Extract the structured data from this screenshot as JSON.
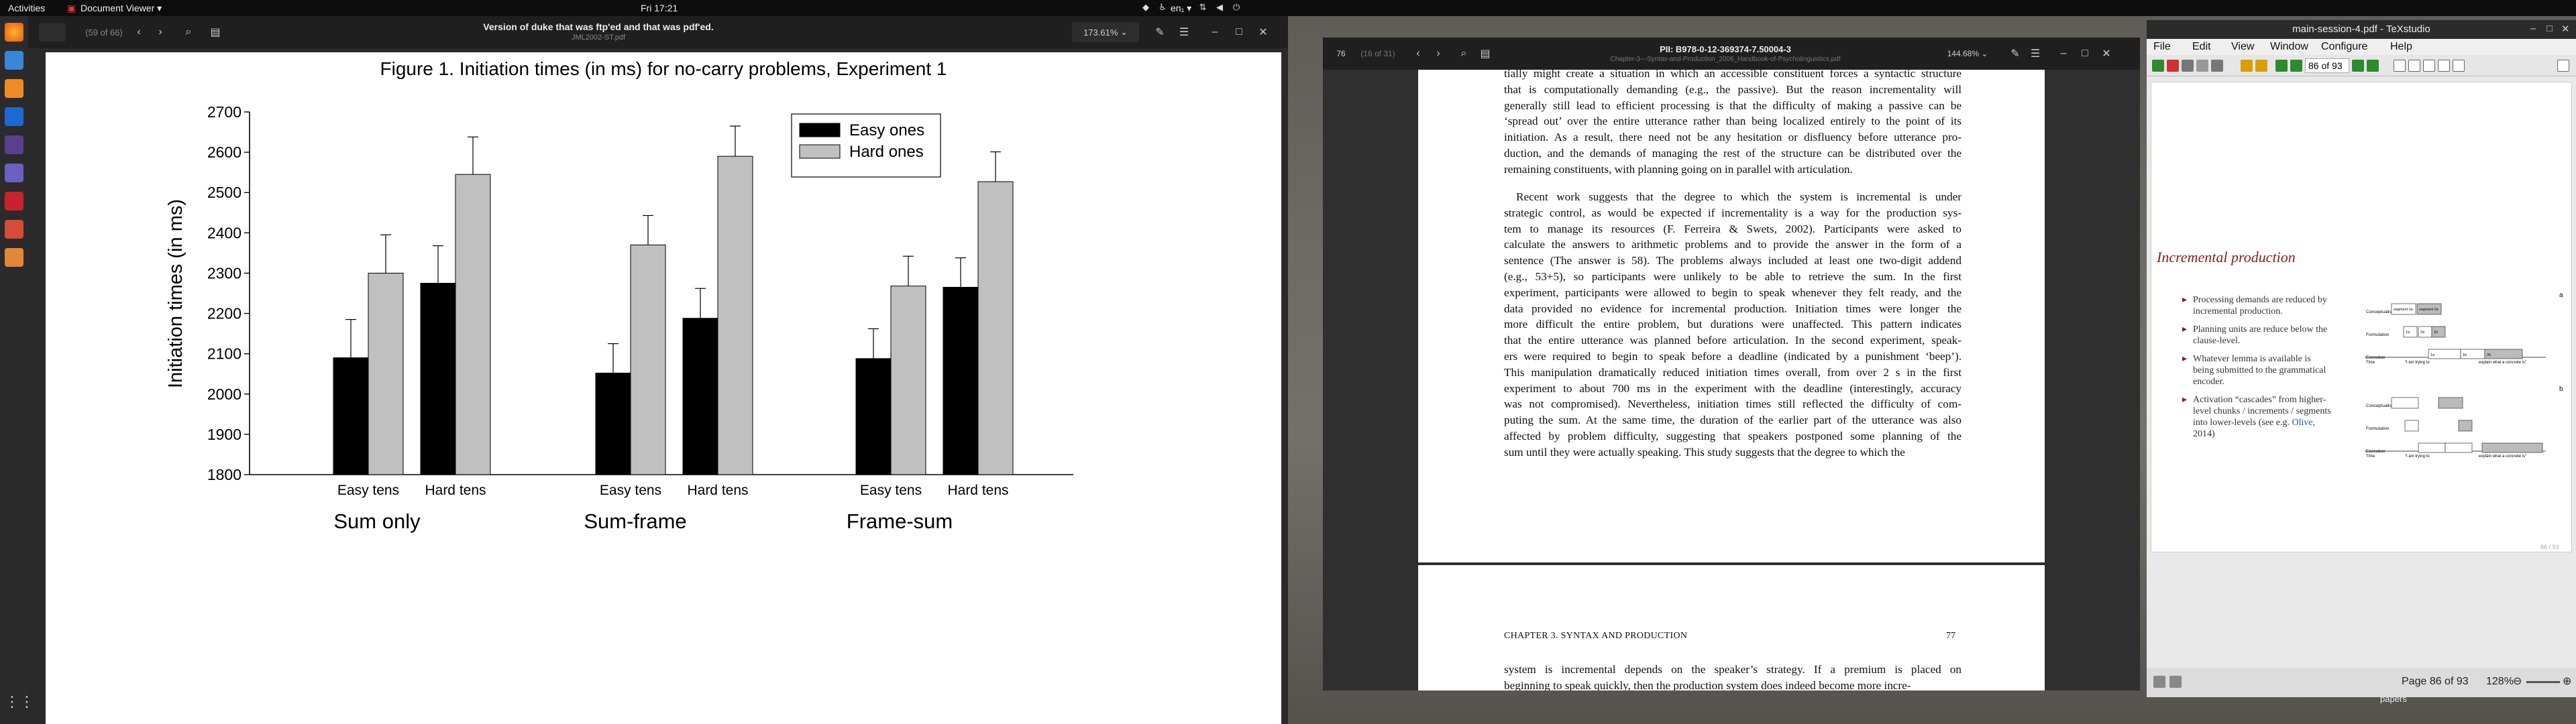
{
  "topbar": {
    "activities": "Activities",
    "app_menu": "Document Viewer ▾",
    "clock": "Fri 17:21",
    "lang": "en₁ ▾"
  },
  "viewer1": {
    "page_count": "(59 of 66)",
    "title": "Version of duke that was ftp'ed and that was pdf'ed.",
    "subtitle": "JML2002-ST.pdf",
    "zoom": "173.61%"
  },
  "chart_data": {
    "type": "bar",
    "title": "Figure 1. Initiation times (in ms) for no-carry problems, Experiment 1",
    "ylabel": "Initiation times (in ms)",
    "ylim": [
      1800,
      2700
    ],
    "yticks": [
      "1800",
      "1900",
      "2000",
      "2100",
      "2200",
      "2300",
      "2400",
      "2500",
      "2600",
      "2700"
    ],
    "groups": [
      "Sum only",
      "Sum-frame",
      "Frame-sum"
    ],
    "subcategories": [
      "Easy tens",
      "Hard tens"
    ],
    "legend": [
      "Easy ones",
      "Hard ones"
    ],
    "legend_position": "top-right",
    "colors": [
      "#000000",
      "#c0c0c0"
    ],
    "bars": [
      {
        "group": "Sum only",
        "category": "Easy tens",
        "series": "Easy ones",
        "value": 2090,
        "err": 2185
      },
      {
        "group": "Sum only",
        "category": "Easy tens",
        "series": "Hard ones",
        "value": 2300,
        "err": 2395
      },
      {
        "group": "Sum only",
        "category": "Hard tens",
        "series": "Easy ones",
        "value": 2275,
        "err": 2368
      },
      {
        "group": "Sum only",
        "category": "Hard tens",
        "series": "Hard ones",
        "value": 2545,
        "err": 2638
      },
      {
        "group": "Sum-frame",
        "category": "Easy tens",
        "series": "Easy ones",
        "value": 2052,
        "err": 2125
      },
      {
        "group": "Sum-frame",
        "category": "Easy tens",
        "series": "Hard ones",
        "value": 2370,
        "err": 2443
      },
      {
        "group": "Sum-frame",
        "category": "Hard tens",
        "series": "Easy ones",
        "value": 2188,
        "err": 2262
      },
      {
        "group": "Sum-frame",
        "category": "Hard tens",
        "series": "Hard ones",
        "value": 2590,
        "err": 2665
      },
      {
        "group": "Frame-sum",
        "category": "Easy tens",
        "series": "Easy ones",
        "value": 2088,
        "err": 2162
      },
      {
        "group": "Frame-sum",
        "category": "Easy tens",
        "series": "Hard ones",
        "value": 2268,
        "err": 2342
      },
      {
        "group": "Frame-sum",
        "category": "Hard tens",
        "series": "Easy ones",
        "value": 2265,
        "err": 2338
      },
      {
        "group": "Frame-sum",
        "category": "Hard tens",
        "series": "Hard ones",
        "value": 2527,
        "err": 2601
      }
    ]
  },
  "viewer2": {
    "page_input": "76",
    "page_count": "(16 of 31)",
    "title": "PII: B978-0-12-369374-7.50004-3",
    "subtitle": "Chapter-3---Syntax-and-Production_2006_Handbook-of-Psycholinguistics.pdf",
    "zoom": "144.68%",
    "lines_top": [
      "tially might create a situation in which an accessible constituent forces a syntactic structure",
      "that is computationally demanding (e.g., the passive). But the reason incrementality will",
      "generally still lead to efficient processing is that the difficulty of making a passive can be",
      "‘spread out’ over the entire utterance rather than being localized entirely to the point of its",
      "initiation. As a result, there need not be any hesitation or disfluency before utterance pro-",
      "duction, and the demands of managing the rest of the structure can be distributed over the",
      "remaining constituents, with planning going on in parallel with articulation."
    ],
    "lines_main": [
      "Recent work suggests that the degree to which the system is incremental is under",
      "strategic control, as would be expected if incrementality is a way for the production sys-",
      "tem to manage its resources (F. Ferreira & Swets, 2002). Participants were asked to",
      "calculate the answers to arithmetic problems and to provide the answer in the form of a",
      "sentence (The answer is 58). The problems always included at least one two-digit addend",
      "(e.g., 53+5), so participants were unlikely to be able to retrieve the sum. In the first",
      "experiment, participants were allowed to begin to speak whenever they felt ready, and the",
      "data provided no evidence for incremental production. Initiation times were longer the",
      "more difficult the entire problem, but durations were unaffected. This pattern indicates",
      "that the entire utterance was planned before articulation. In the second experiment, speak-",
      "ers were required to begin to speak before a deadline (indicated by a punishment ‘beep’).",
      "This manipulation dramatically reduced initiation times overall, from over 2 s in the first",
      "experiment to about 700 ms in the experiment with the deadline (interestingly, accuracy",
      "was not compromised). Nevertheless, initiation times still reflected the difficulty of com-",
      "puting the sum. At the same time, the duration of the earlier part of the utterance was also",
      "affected by problem difficulty, suggesting that speakers postponed some planning of the",
      "sum until they were actually speaking. This study suggests that the degree to which the"
    ],
    "running_head": "CHAPTER 3.  SYNTAX AND PRODUCTION",
    "page_number": "77",
    "lines_next": [
      "system is incremental depends on the speaker’s strategy. If a premium is placed on",
      "beginning to speak quickly, then the production system does indeed become more incre-"
    ]
  },
  "texstudio": {
    "title": "main-session-4.pdf - TeXstudio",
    "menu": [
      "File",
      "Edit",
      "View",
      "Window",
      "Configure",
      "Help"
    ],
    "page_field": "86 of 93",
    "slide_title": "Incremental production",
    "bullets": [
      "Processing demands are reduced by incremental production.",
      "Planning units are reduce below the clause-level.",
      "Whatever lemma is available is being submitted to the grammatical encoder.",
      "Activation “cascades” from higher-level chunks / increments / segments into lower-levels (see e.g. Olive, 2014)"
    ],
    "link_text": "Olive,",
    "diagram_rows": [
      "Conceptualisation",
      "Formulation",
      "Execution"
    ],
    "diagram_labels": [
      "a",
      "b"
    ],
    "diagram_axis": [
      "Time",
      "“I am trying to",
      "explain what a concrete is”"
    ],
    "diagram_segments": [
      "segment 1a",
      "segment 2a",
      "1a",
      "2a",
      "1b",
      "1a",
      "1b",
      "2b",
      "segment 2a",
      "1a"
    ],
    "status_page": "Page 86 of 93",
    "status_zoom": "128%",
    "status_slide": "86 / 93",
    "taskbar_text": "papers"
  }
}
